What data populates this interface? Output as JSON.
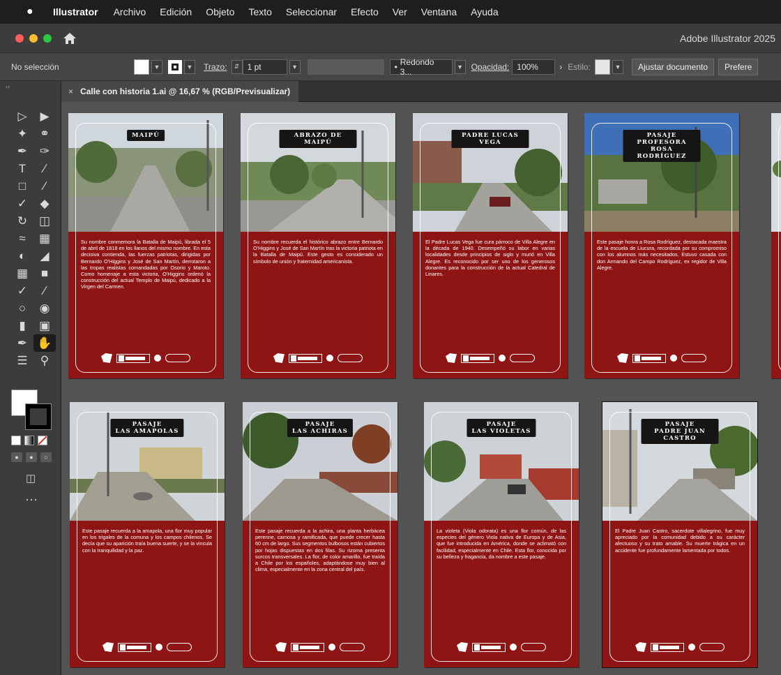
{
  "menubar": {
    "app": "Illustrator",
    "items": [
      "Archivo",
      "Edición",
      "Objeto",
      "Texto",
      "Seleccionar",
      "Efecto",
      "Ver",
      "Ventana",
      "Ayuda"
    ]
  },
  "titlebar": {
    "title": "Adobe Illustrator 2025"
  },
  "control": {
    "selection": "No selección",
    "stroke_label": "Trazo:",
    "stroke_value": "1 pt",
    "brush": "Redondo 3...",
    "opacity_label": "Opacidad:",
    "opacity_value": "100%",
    "style_label": "Estilo:",
    "adjust_button": "Ajustar documento",
    "prefs_button": "Prefere"
  },
  "document": {
    "tab_title": "Calle con historia 1.ai @ 16,67 % (RGB/Previsualizar)"
  },
  "colors": {
    "artboard_bg": "#8f1414",
    "accent": "#1473e6"
  },
  "artboards": [
    {
      "title": "MAIPÚ",
      "text": "Su nombre conmemora la Batalla de Maipú, librada el 5 de abril de 1818 en los llanos del mismo nombre. En esta decisiva contienda, las fuerzas patriotas, dirigidas por Bernardo O'Higgins y José de San Martín, derrotaron a las tropas realistas comandadas por Osorio y Maroto. Como homenaje a esta victoria, O'Higgins ordenó la construcción del actual Templo de Maipú, dedicado a la Virgen del Carmen."
    },
    {
      "title": "ABRAZO DE MAIPÚ",
      "text": "Su nombre recuerda el histórico abrazo entre Bernardo O'Higgins y José de San Martín tras la victoria patriota en la Batalla de Maipú. Este gesto es considerado un símbolo de unión y fraternidad americanista."
    },
    {
      "title": "PADRE LUCAS VEGA",
      "text": "El Padre Lucas Vega fue cura párroco de Villa Alegre en la década de 1940. Desempeñó su labor en varias localidades desde principios de siglo y murió en Villa Alegre. Es reconocido por ser uno de los generosos donantes para la construcción de la actual Catedral de Linares."
    },
    {
      "title": "PASAJE PROFESORA\nROSA RODRÍGUEZ",
      "text": "Este pasaje honra a Rosa Rodríguez, destacada maestra de la escuela de Liucura, recordada por su compromiso con los alumnos más necesitados. Estuvo casada con don Armando del Campo Rodríguez, ex regidor de Villa Alegre."
    },
    {
      "title": "PASAJE\nLAS AMAPOLAS",
      "text": "Este pasaje recuerda a la amapola, una flor muy popular en los trigales de la comuna y los campos chilenos. Se decía que su aparición traía buena suerte, y se la vincula con la tranquilidad y la paz."
    },
    {
      "title": "PASAJE\nLAS ACHIRAS",
      "text": "Este pasaje recuerda a la achira, una planta herbácea perenne, carnosa y ramificada, que puede crecer hasta 60 cm de largo. Sus segmentos bulbosos están cubiertos por hojas dispuestas en dos filas. Su rizoma presenta surcos transversales. La flor, de color amarillo, fue traída a Chile por los españoles, adaptándose muy bien al clima, especialmente en la zona central del país."
    },
    {
      "title": "PASAJE\nLAS VIOLETAS",
      "text": "La violeta (Viola odorata) es una flor común, de las especies del género Viola nativa de Europa y de Asia, que fue introducida en América, donde se aclimató con facilidad, especialmente en Chile. Esta flor, conocida por su belleza y fragancia, da nombre a este pasaje."
    },
    {
      "title": "PASAJE\nPADRE JUAN CASTRO",
      "text": "El Padre Juan Castro, sacerdote villalegrino, fue muy apreciado por la comunidad debido a su carácter afectuoso y su trato amable. Su muerte trágica en un accidente fue profundamente lamentada por todos."
    }
  ]
}
